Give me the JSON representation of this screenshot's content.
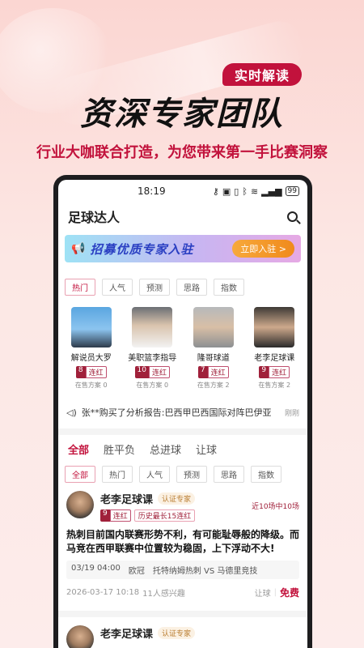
{
  "hero": {
    "badge": "实时解读",
    "title": "资深专家团队",
    "subtitle": "行业大咖联合打造，为您带来第一手比赛洞察"
  },
  "status": {
    "time": "18:19",
    "battery": "99"
  },
  "app": {
    "title": "足球达人"
  },
  "banner": {
    "text": "招募优质专家入驻",
    "join": "立即入驻 >"
  },
  "chips1": [
    "热门",
    "人气",
    "预测",
    "思路",
    "指数"
  ],
  "experts": [
    {
      "name": "解说员大罗",
      "streak": "8",
      "label": "连红",
      "onsale": "在售方案 0"
    },
    {
      "name": "美职篮李指导",
      "streak": "10",
      "label": "连红",
      "onsale": "在售方案 0"
    },
    {
      "name": "隆哥球道",
      "streak": "7",
      "label": "连红",
      "onsale": "在售方案 2"
    },
    {
      "name": "老李足球课",
      "streak": "9",
      "label": "连红",
      "onsale": "在售方案 2"
    }
  ],
  "ticker": {
    "text": "张**购买了分析报告:巴西甲巴西国际对阵巴伊亚",
    "ago": "刚刚"
  },
  "tabs": [
    "全部",
    "胜平负",
    "总进球",
    "让球"
  ],
  "chips2": [
    "全部",
    "热门",
    "人气",
    "预测",
    "思路",
    "指数"
  ],
  "card": {
    "name": "老李足球课",
    "cert": "认证专家",
    "streak": "9",
    "streak_label": "连红",
    "history": "历史最长15连红",
    "record": "近10场中10场",
    "body": "热刺目前国内联赛形势不利，有可能耻辱般的降级。而马竞在西甲联赛中位置较为稳固，上下浮动不大!",
    "match_time": "03/19 04:00",
    "league": "欧冠",
    "match": "托特纳姆热刺 VS 马德里竞技",
    "date": "2026-03-17 10:18",
    "interest": "11人感兴趣",
    "kind": "让球",
    "price": "免费"
  },
  "card2": {
    "name": "老李足球课",
    "cert": "认证专家"
  }
}
